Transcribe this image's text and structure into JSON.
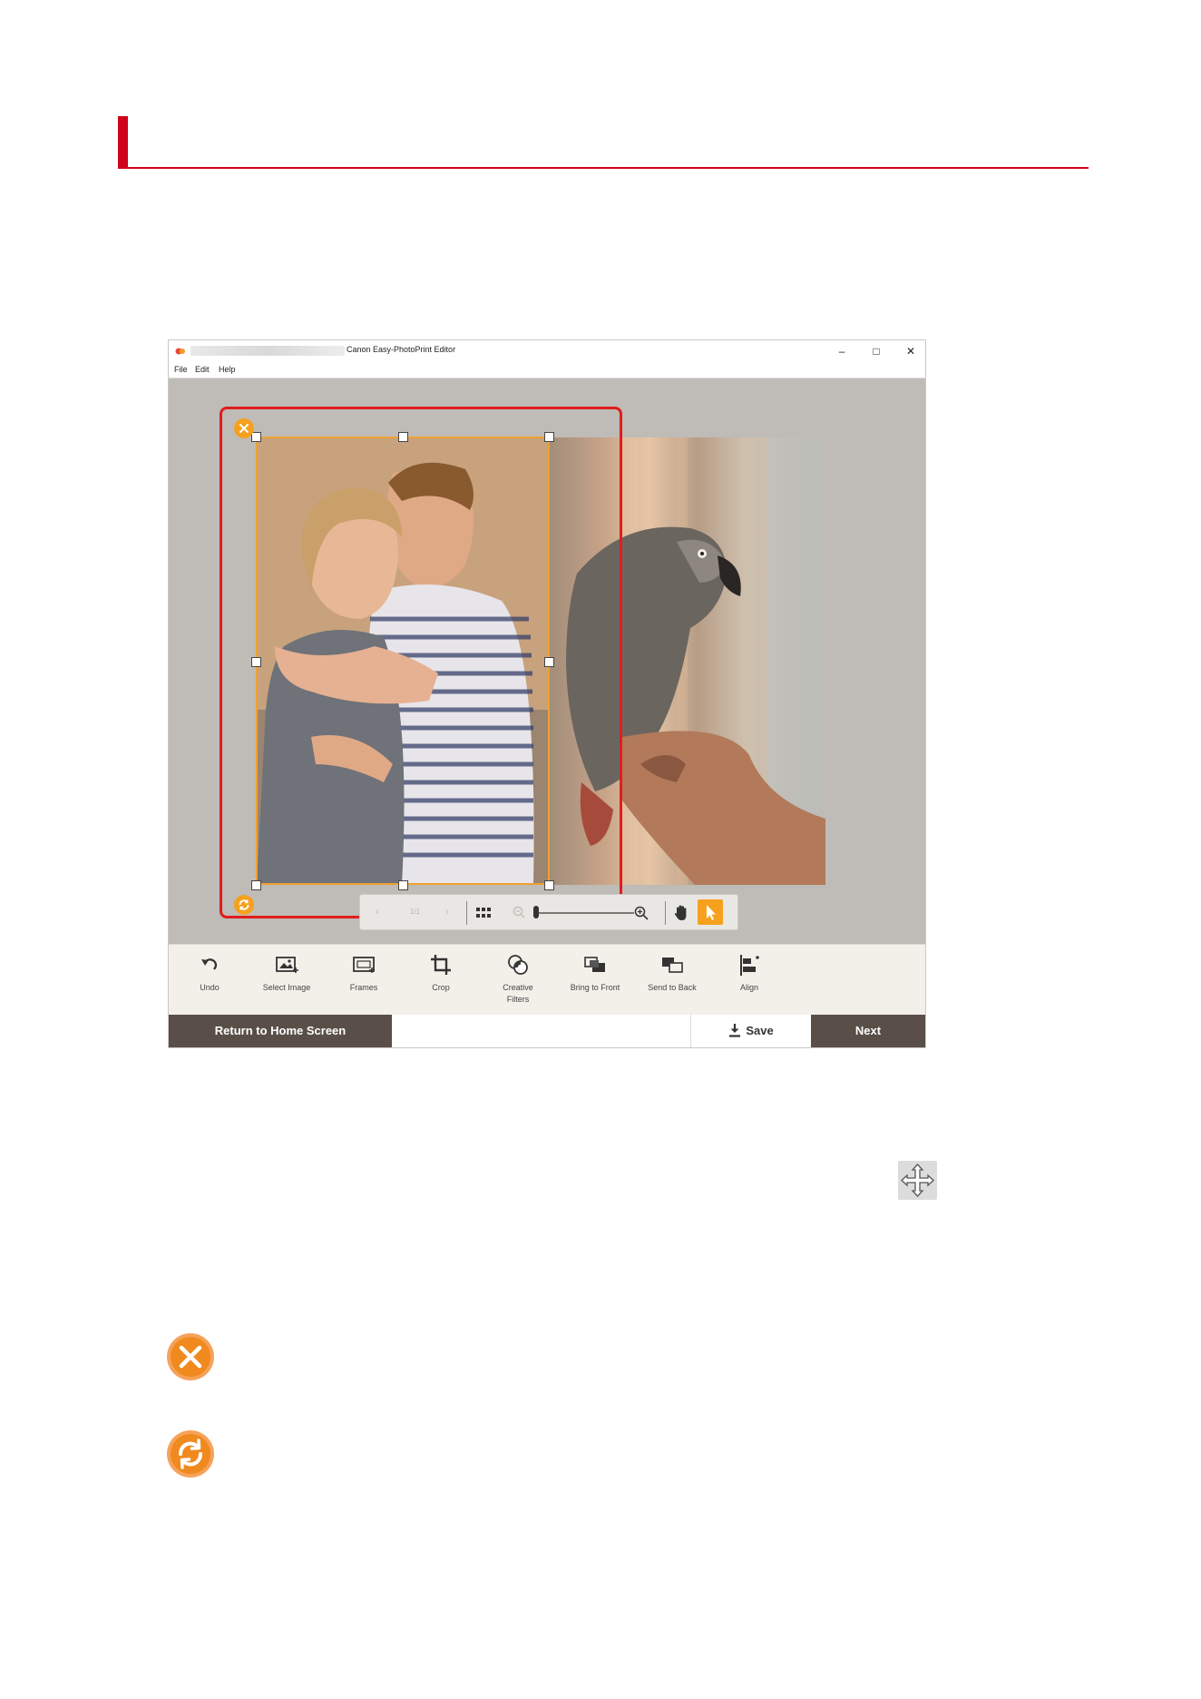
{
  "app": {
    "title": "Canon Easy-PhotoPrint Editor",
    "window_controls": {
      "minimize": "–",
      "maximize": "□",
      "close": "✕"
    },
    "menu": [
      "File",
      "Edit",
      "Help"
    ]
  },
  "nav_toolbar": {
    "page_counter": "1/1"
  },
  "tools": [
    {
      "label": "Undo",
      "icon": "undo-icon"
    },
    {
      "label": "Select Image",
      "icon": "select-image-icon"
    },
    {
      "label": "Frames",
      "icon": "frames-icon"
    },
    {
      "label": "Crop",
      "icon": "crop-icon"
    },
    {
      "label": "Creative",
      "label2": "Filters",
      "icon": "creative-filters-icon"
    },
    {
      "label": "Bring to Front",
      "icon": "bring-to-front-icon"
    },
    {
      "label": "Send to Back",
      "icon": "send-to-back-icon"
    },
    {
      "label": "Align",
      "icon": "align-icon"
    }
  ],
  "actions": {
    "home": "Return to Home Screen",
    "save": "Save",
    "next": "Next"
  },
  "colors": {
    "heading_red": "#d0021b",
    "accent_orange": "#f5a11e",
    "highlight_red": "#e11d1d",
    "dark_button": "#5a4f48"
  }
}
